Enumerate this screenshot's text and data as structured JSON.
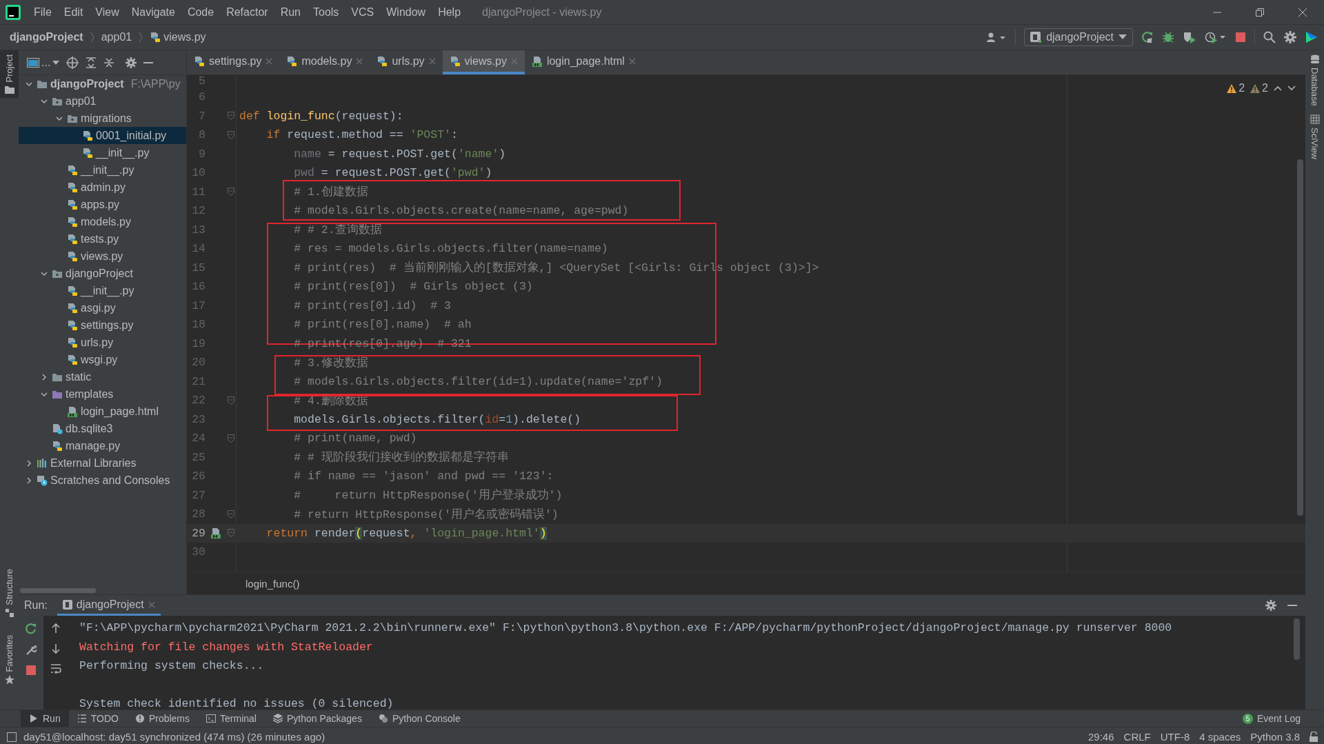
{
  "window": {
    "title": "djangoProject - views.py"
  },
  "menu": [
    "File",
    "Edit",
    "View",
    "Navigate",
    "Code",
    "Refactor",
    "Run",
    "Tools",
    "VCS",
    "Window",
    "Help"
  ],
  "breadcrumb": [
    "djangoProject",
    "app01",
    "views.py"
  ],
  "run_config": "djangoProject",
  "left_strip": [
    {
      "label": "Project",
      "selected": true
    },
    {
      "label": "Structure",
      "selected": false
    },
    {
      "label": "Favorites",
      "selected": false
    }
  ],
  "right_strip": [
    "Database",
    "SciView"
  ],
  "project_view": "...",
  "tree": [
    {
      "label": "djangoProject",
      "hint": "F:\\APP\\py",
      "kind": "root",
      "expanded": true,
      "selected": false,
      "children": [
        {
          "label": "app01",
          "kind": "package",
          "expanded": true,
          "selected": false,
          "children": [
            {
              "label": "migrations",
              "kind": "package",
              "expanded": true,
              "selected": false,
              "children": [
                {
                  "label": "0001_initial.py",
                  "kind": "python",
                  "selected": true
                },
                {
                  "label": "__init__.py",
                  "kind": "python",
                  "selected": false
                }
              ]
            },
            {
              "label": "__init__.py",
              "kind": "python",
              "selected": false
            },
            {
              "label": "admin.py",
              "kind": "python",
              "selected": false
            },
            {
              "label": "apps.py",
              "kind": "python",
              "selected": false
            },
            {
              "label": "models.py",
              "kind": "python",
              "selected": false
            },
            {
              "label": "tests.py",
              "kind": "python",
              "selected": false
            },
            {
              "label": "views.py",
              "kind": "python",
              "selected": false
            }
          ]
        },
        {
          "label": "djangoProject",
          "kind": "package",
          "expanded": true,
          "selected": false,
          "children": [
            {
              "label": "__init__.py",
              "kind": "python",
              "selected": false
            },
            {
              "label": "asgi.py",
              "kind": "python",
              "selected": false
            },
            {
              "label": "settings.py",
              "kind": "python",
              "selected": false
            },
            {
              "label": "urls.py",
              "kind": "python",
              "selected": false
            },
            {
              "label": "wsgi.py",
              "kind": "python",
              "selected": false
            }
          ]
        },
        {
          "label": "static",
          "kind": "folder",
          "expanded": false,
          "selected": false
        },
        {
          "label": "templates",
          "kind": "templates",
          "expanded": true,
          "selected": false,
          "children": [
            {
              "label": "login_page.html",
              "kind": "html",
              "selected": false
            }
          ]
        },
        {
          "label": "db.sqlite3",
          "kind": "database",
          "selected": false
        },
        {
          "label": "manage.py",
          "kind": "python",
          "selected": false
        }
      ]
    },
    {
      "label": "External Libraries",
      "kind": "libraries",
      "expanded": false,
      "selected": false
    },
    {
      "label": "Scratches and Consoles",
      "kind": "scratches",
      "expanded": false,
      "selected": false
    }
  ],
  "editor_tabs": [
    {
      "label": "settings.py",
      "kind": "python",
      "selected": false
    },
    {
      "label": "models.py",
      "kind": "python",
      "selected": false
    },
    {
      "label": "urls.py",
      "kind": "python",
      "selected": false
    },
    {
      "label": "views.py",
      "kind": "python",
      "selected": true
    },
    {
      "label": "login_page.html",
      "kind": "html",
      "selected": false
    }
  ],
  "inspections": {
    "warnings": "2",
    "weak_warnings": "2"
  },
  "code_blocks": [
    {
      "boxed": false,
      "lines": [
        {
          "number": "5",
          "current": false
        },
        {
          "number": "6",
          "current": false
        },
        {
          "number": "7",
          "fold": true,
          "current": false,
          "segments": [
            {
              "kind": "kw",
              "text": "def "
            },
            {
              "kind": "fn",
              "text": "login_func"
            },
            {
              "kind": "plain",
              "text": "(request):"
            }
          ]
        },
        {
          "number": "8",
          "fold": true,
          "current": false,
          "segments": [
            {
              "kind": "kw",
              "text": "    if "
            },
            {
              "kind": "plain",
              "text": "request.method == "
            },
            {
              "kind": "str",
              "text": "'POST'"
            },
            {
              "kind": "plain",
              "text": ":"
            }
          ]
        },
        {
          "number": "9",
          "current": false,
          "segments": [
            {
              "kind": "unused",
              "text": "        name"
            },
            {
              "kind": "plain",
              "text": " = request.POST.get("
            },
            {
              "kind": "str",
              "text": "'name'"
            },
            {
              "kind": "plain",
              "text": ")"
            }
          ]
        },
        {
          "number": "10",
          "current": false,
          "segments": [
            {
              "kind": "unused",
              "text": "        pwd"
            },
            {
              "kind": "plain",
              "text": " = request.POST.get("
            },
            {
              "kind": "str",
              "text": "'pwd'"
            },
            {
              "kind": "plain",
              "text": ")"
            }
          ]
        }
      ]
    },
    {
      "boxed": true,
      "lines": [
        {
          "number": "11",
          "fold": true,
          "current": false,
          "segments": [
            {
              "kind": "com",
              "text": "        # 1.创建数据"
            }
          ]
        },
        {
          "number": "12",
          "current": false,
          "segments": [
            {
              "kind": "com",
              "text": "        # models.Girls.objects.create(name=name, age=pwd)"
            }
          ]
        }
      ]
    },
    {
      "boxed": true,
      "lines": [
        {
          "number": "13",
          "current": false,
          "segments": [
            {
              "kind": "com",
              "text": "        # # 2.查询数据"
            }
          ]
        },
        {
          "number": "14",
          "current": false,
          "segments": [
            {
              "kind": "com",
              "text": "        # res = models.Girls.objects.filter(name=name)"
            }
          ]
        },
        {
          "number": "15",
          "current": false,
          "segments": [
            {
              "kind": "com",
              "text": "        # print(res)  # 当前刚刚输入的[数据对象,] <QuerySet [<Girls: Girls object (3)>]>"
            }
          ]
        },
        {
          "number": "16",
          "current": false,
          "segments": [
            {
              "kind": "com",
              "text": "        # print(res[0])  # Girls object (3)"
            }
          ]
        },
        {
          "number": "17",
          "current": false,
          "segments": [
            {
              "kind": "com",
              "text": "        # print(res[0].id)  # 3"
            }
          ]
        },
        {
          "number": "18",
          "current": false,
          "segments": [
            {
              "kind": "com",
              "text": "        # print(res[0].name)  # ah"
            }
          ]
        }
      ]
    },
    {
      "boxed": false,
      "lines": [
        {
          "number": "19",
          "current": false,
          "segments": [
            {
              "kind": "com",
              "text": "        # print(res[0].age)  # 321"
            }
          ]
        }
      ]
    },
    {
      "boxed": true,
      "lines": [
        {
          "number": "20",
          "current": false,
          "segments": [
            {
              "kind": "com",
              "text": "        # 3.修改数据"
            }
          ]
        },
        {
          "number": "21",
          "current": false,
          "segments": [
            {
              "kind": "com",
              "text": "        # models.Girls.objects.filter(id=1).update(name='zpf')"
            }
          ]
        }
      ]
    },
    {
      "boxed": true,
      "lines": [
        {
          "number": "22",
          "fold": true,
          "current": false,
          "segments": [
            {
              "kind": "com",
              "text": "        # 4.删除数据"
            }
          ]
        },
        {
          "number": "23",
          "current": false,
          "segments": [
            {
              "kind": "plain",
              "text": "        models.Girls.objects.filter("
            },
            {
              "kind": "param",
              "text": "id"
            },
            {
              "kind": "plain",
              "text": "="
            },
            {
              "kind": "num",
              "text": "1"
            },
            {
              "kind": "plain",
              "text": ").delete()"
            }
          ]
        }
      ]
    },
    {
      "boxed": false,
      "lines": [
        {
          "number": "24",
          "fold": true,
          "current": false,
          "segments": [
            {
              "kind": "com",
              "text": "        # print(name, pwd)"
            }
          ]
        },
        {
          "number": "25",
          "current": false,
          "segments": [
            {
              "kind": "com",
              "text": "        # # 现阶段我们接收到的数据都是字符串"
            }
          ]
        },
        {
          "number": "26",
          "current": false,
          "segments": [
            {
              "kind": "com",
              "text": "        # if name == 'jason' and pwd == '123':"
            }
          ]
        },
        {
          "number": "27",
          "current": false,
          "segments": [
            {
              "kind": "com",
              "text": "        #     return HttpResponse('用户登录成功')"
            }
          ]
        },
        {
          "number": "28",
          "fold": true,
          "current": false,
          "segments": [
            {
              "kind": "com",
              "text": "        # return HttpResponse('用户名或密码错误')"
            }
          ]
        },
        {
          "number": "29",
          "fold": true,
          "current": true,
          "segments": [
            {
              "kind": "kw",
              "text": "    return "
            },
            {
              "kind": "plain",
              "text": "render"
            },
            {
              "kind": "match",
              "text": "("
            },
            {
              "kind": "plain",
              "text": "request"
            },
            {
              "kind": "kw",
              "text": ", "
            },
            {
              "kind": "str",
              "text": "'login_page.html'"
            },
            {
              "kind": "match",
              "text": ")"
            }
          ]
        },
        {
          "number": "30",
          "current": false
        }
      ]
    }
  ],
  "editor_breadcrumb": "login_func()",
  "run": {
    "label": "Run:",
    "tab": "djangoProject",
    "output": [
      {
        "kind": "info",
        "gap_before": false,
        "text": "\"F:\\APP\\pycharm\\pycharm2021\\PyCharm 2021.2.2\\bin\\runnerw.exe\" F:\\python\\python3.8\\python.exe F:/APP/pycharm/pythonProject/djangoProject/manage.py runserver 8000"
      },
      {
        "kind": "error",
        "gap_before": false,
        "text": "Watching for file changes with StatReloader"
      },
      {
        "kind": "info",
        "gap_before": false,
        "text": "Performing system checks..."
      },
      {
        "kind": "info",
        "gap_before": true,
        "text": "System check identified no issues (0 silenced)"
      }
    ]
  },
  "bottom_tabs": [
    {
      "label": "Run",
      "kind": "run",
      "selected": true
    },
    {
      "label": "TODO",
      "kind": "todo",
      "selected": false
    },
    {
      "label": "Problems",
      "kind": "problems",
      "selected": false
    },
    {
      "label": "Terminal",
      "kind": "terminal",
      "selected": false
    },
    {
      "label": "Python Packages",
      "kind": "packages",
      "selected": false
    },
    {
      "label": "Python Console",
      "kind": "console",
      "selected": false
    }
  ],
  "event_log": {
    "count": "5",
    "label": "Event Log"
  },
  "status": {
    "message": "day51@localhost: day51 synchronized (474 ms) (26 minutes ago)",
    "items": [
      "29:46",
      "CRLF",
      "UTF-8",
      "4 spaces",
      "Python 3.8"
    ]
  }
}
